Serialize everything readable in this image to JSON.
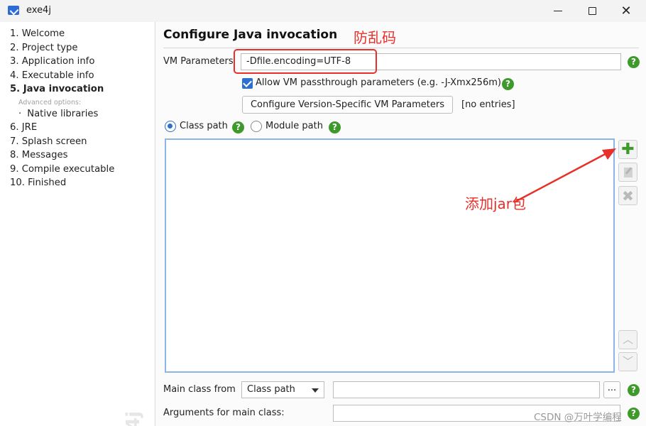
{
  "window": {
    "title": "exe4j"
  },
  "sidebar": {
    "steps": [
      "1. Welcome",
      "2. Project type",
      "3. Application info",
      "4. Executable info",
      "5. Java invocation",
      "Advanced options:",
      "Native libraries",
      "6. JRE",
      "7. Splash screen",
      "8. Messages",
      "9. Compile executable",
      "10. Finished"
    ],
    "active_index": 4,
    "logo_text": "4j"
  },
  "main": {
    "title": "Configure Java invocation",
    "annotation_top": "防乱码",
    "annotation_list": "添加jar包",
    "vm_parameters": {
      "label": "VM Parameters",
      "value": "-Dfile.encoding=UTF-8"
    },
    "allow_passthrough": {
      "label": "Allow VM passthrough parameters (e.g. -J-Xmx256m)",
      "checked": true
    },
    "configure_button": "Configure Version-Specific VM Parameters",
    "entries_status": "[no entries]",
    "path_mode": {
      "class_path": "Class path",
      "module_path": "Module path",
      "selected": "Class path"
    },
    "main_class": {
      "label": "Main class from",
      "selected": "Class path",
      "value": ""
    },
    "browse_button": "...",
    "arguments": {
      "label": "Arguments for main class:",
      "value": ""
    },
    "help_glyph": "?"
  },
  "icons": {
    "add": "plus-icon",
    "edit": "edit-icon",
    "delete": "delete-icon",
    "move_up": "arrow-up-icon",
    "move_down": "arrow-down-icon"
  },
  "colors": {
    "accent": "#2b6fd1",
    "help": "#3f9a2c",
    "annotation": "#e8302a",
    "list_border": "#8db6e8"
  },
  "watermark": "CSDN @万叶学编程"
}
